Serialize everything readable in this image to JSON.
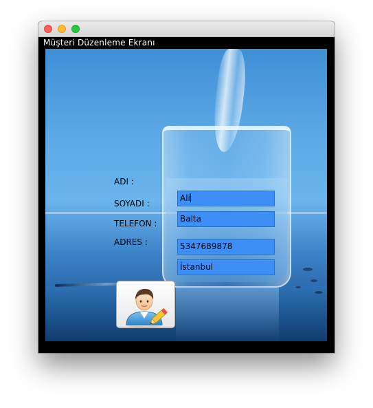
{
  "window": {
    "title": "Müşteri Düzenleme Ekranı"
  },
  "form": {
    "name_label": "ADI :",
    "name_value": "Ali",
    "surname_label": "SOYADI :",
    "surname_value": "Balta",
    "phone_label": "TELEFON :",
    "phone_value": "5347689878",
    "address_label": "ADRES :",
    "address_value": "İstanbul"
  },
  "edit_button": {
    "icon": "user-edit-icon"
  },
  "colors": {
    "field_background": "#3d8ff5",
    "window_frame": "#000000"
  }
}
